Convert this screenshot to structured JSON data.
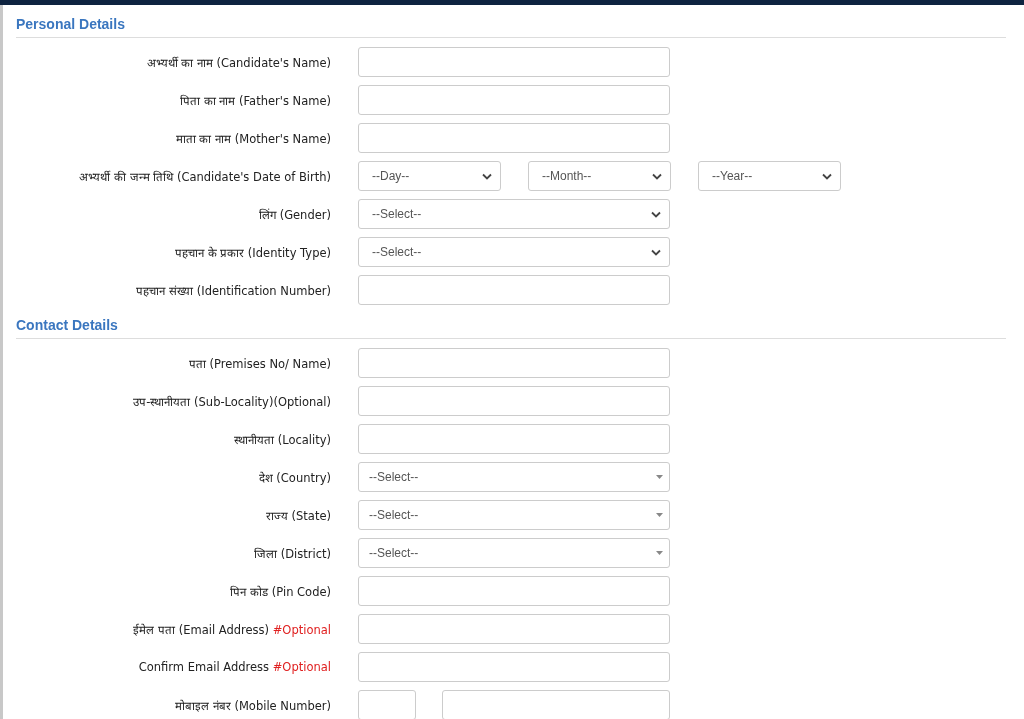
{
  "sections": [
    {
      "title": "Personal Details",
      "fields": [
        {
          "kind": "text",
          "label": "अभ्यर्थी का नाम (Candidate's Name)"
        },
        {
          "kind": "text",
          "label": "पिता का नाम (Father's Name)"
        },
        {
          "kind": "text",
          "label": "माता का नाम (Mother's Name)"
        },
        {
          "kind": "date",
          "label": "अभ्यर्थी की जन्म तिथि (Candidate's Date of Birth)",
          "options": [
            "--Day--",
            "--Month--",
            "--Year--"
          ]
        },
        {
          "kind": "select",
          "label": "लिंग (Gender)",
          "value": "--Select--"
        },
        {
          "kind": "select",
          "label": "पहचान के प्रकार (Identity Type)",
          "value": "--Select--"
        },
        {
          "kind": "text",
          "label": "पहचान संख्या (Identification Number)"
        }
      ]
    },
    {
      "title": "Contact Details",
      "fields": [
        {
          "kind": "text",
          "label": "पता (Premises No/ Name)"
        },
        {
          "kind": "text",
          "label": "उप-स्थानीयता (Sub-Locality)(Optional)"
        },
        {
          "kind": "text",
          "label": "स्थानीयता (Locality)"
        },
        {
          "kind": "combo",
          "label": "देश (Country)",
          "value": "--Select--"
        },
        {
          "kind": "combo",
          "label": "राज्य (State)",
          "value": "--Select--"
        },
        {
          "kind": "combo",
          "label": "जिला (District)",
          "value": "--Select--"
        },
        {
          "kind": "text",
          "label": "पिन कोड (Pin Code)"
        },
        {
          "kind": "text",
          "label": "ईमेल पता (Email Address)",
          "note": "#Optional"
        },
        {
          "kind": "text",
          "label": "Confirm Email Address",
          "note": "#Optional"
        },
        {
          "kind": "phone",
          "label": "मोबाइल नंबर (Mobile Number)"
        }
      ]
    }
  ]
}
